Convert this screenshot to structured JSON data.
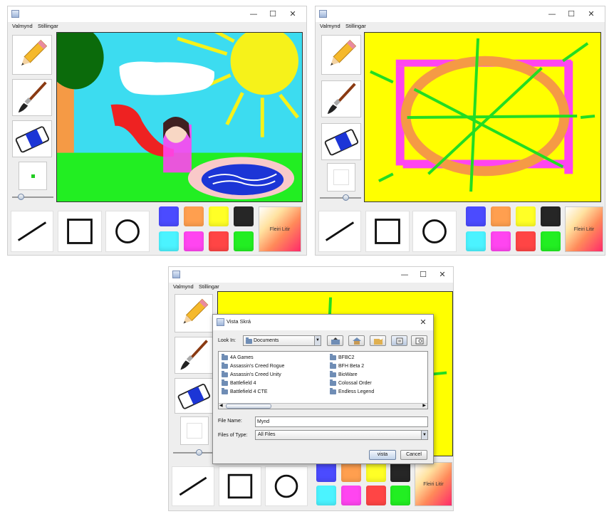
{
  "menu": {
    "file": "Valmynd",
    "settings": "Stillingar"
  },
  "window_controls": {
    "minimize": "—",
    "maximize": "☐",
    "close": "✕"
  },
  "palette": {
    "colors": [
      "#4b4bff",
      "#ff9f4f",
      "#ffff26",
      "#262626",
      "#4bf3ff",
      "#ff45f0",
      "#ff4545",
      "#22ee22"
    ],
    "more_colors_label": "Fleiri Litir"
  },
  "tools": [
    "pencil-icon",
    "brush-icon",
    "eraser-icon"
  ],
  "shapes": [
    "line",
    "rectangle",
    "circle"
  ],
  "dialog": {
    "title": "Vista Skrá",
    "look_in_label": "Look In:",
    "look_in_value": "Documents",
    "files_left": [
      "4A Games",
      "Assassin's Creed Rogue",
      "Assassin's Creed Unity",
      "Battlefield 4",
      "Battlefield 4 CTE"
    ],
    "files_right": [
      "BFBC2",
      "BFH Beta 2",
      "BioWare",
      "Colossal Order",
      "Endless Legend"
    ],
    "file_name_label": "File Name:",
    "file_name_value": "Mynd",
    "files_of_type_label": "Files of Type:",
    "files_of_type_value": "All Files",
    "save_button": "vista",
    "cancel_button": "Cancel"
  }
}
